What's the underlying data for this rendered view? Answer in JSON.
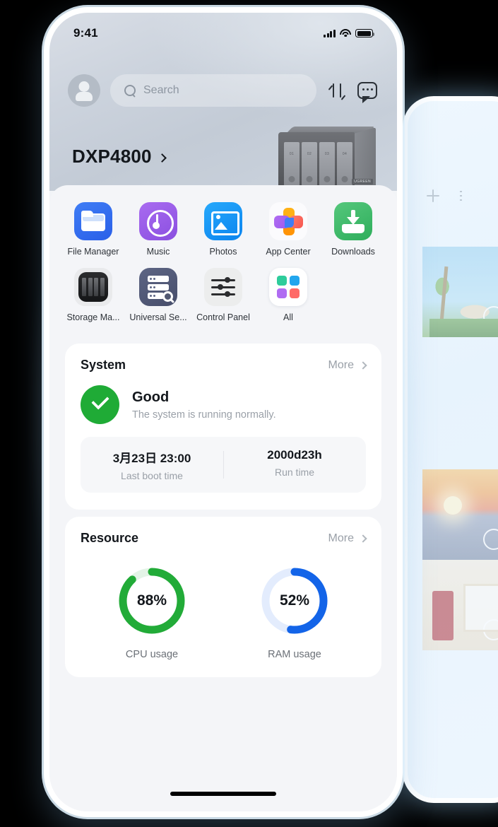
{
  "statusbar": {
    "time": "9:41",
    "signal_icon": "cellular-bars-icon",
    "wifi_icon": "wifi-icon",
    "battery_icon": "battery-icon"
  },
  "header": {
    "avatar_icon": "avatar-icon",
    "search": {
      "placeholder": "Search",
      "icon": "search-icon"
    },
    "transfer_icon": "transfer-icon",
    "chat_icon": "chat-bubble-icon"
  },
  "device": {
    "name": "DXP4800",
    "chevron_icon": "chevron-right-icon",
    "bays": [
      "01",
      "02",
      "03",
      "04"
    ],
    "brand": "UGREEN"
  },
  "apps": [
    {
      "label": "File Manager",
      "icon": "file-manager-icon"
    },
    {
      "label": "Music",
      "icon": "music-icon"
    },
    {
      "label": "Photos",
      "icon": "photos-icon"
    },
    {
      "label": "App Center",
      "icon": "app-center-icon"
    },
    {
      "label": "Downloads",
      "icon": "downloads-icon"
    },
    {
      "label": "Storage Ma...",
      "icon": "storage-manager-icon"
    },
    {
      "label": "Universal Se...",
      "icon": "universal-search-icon"
    },
    {
      "label": "Control Panel",
      "icon": "control-panel-icon"
    },
    {
      "label": "All",
      "icon": "all-apps-icon"
    }
  ],
  "system_card": {
    "title": "System",
    "more_label": "More",
    "status_icon": "check-circle-icon",
    "status_title": "Good",
    "status_desc": "The system is running normally.",
    "stats": [
      {
        "value": "3月23日 23:00",
        "label": "Last boot time"
      },
      {
        "value": "2000d23h",
        "label": "Run time"
      }
    ]
  },
  "resource_card": {
    "title": "Resource",
    "more_label": "More",
    "gauges": [
      {
        "value_label": "88%",
        "label": "CPU usage"
      },
      {
        "value_label": "52%",
        "label": "RAM usage"
      }
    ]
  },
  "chart_data": [
    {
      "type": "pie",
      "title": "CPU usage",
      "categories": [
        "used",
        "free"
      ],
      "values": [
        88,
        12
      ],
      "unit": "%",
      "colors": [
        "#22ab38",
        "#e4f4e7"
      ],
      "start_angle": 0
    },
    {
      "type": "pie",
      "title": "RAM usage",
      "categories": [
        "used",
        "free"
      ],
      "values": [
        52,
        48
      ],
      "unit": "%",
      "colors": [
        "#1364e8",
        "#e3ecfd"
      ],
      "start_angle": 0
    }
  ],
  "background_phone": {
    "add_icon": "plus-icon",
    "list_icon": "list-view-icon",
    "photos": [
      "palm-tree-photo",
      "sunset-ocean-photo",
      "house-porch-photo"
    ]
  },
  "colors": {
    "green": "#22ab38",
    "blue": "#1364e8",
    "green_track": "#e4f4e7",
    "blue_track": "#e3ecfd"
  }
}
